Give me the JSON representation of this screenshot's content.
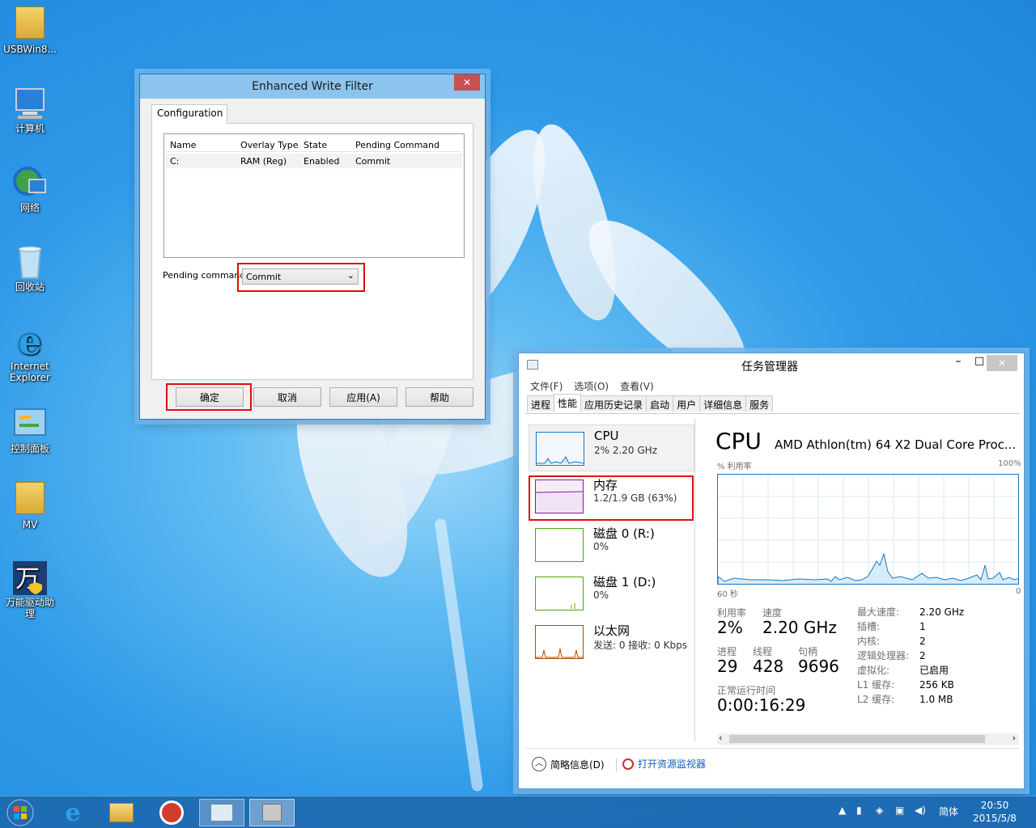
{
  "desktop": {
    "icons": [
      {
        "label": "USBWin8..."
      },
      {
        "label": "计算机"
      },
      {
        "label": "网络"
      },
      {
        "label": "回收站"
      },
      {
        "label": "Internet Explorer"
      },
      {
        "label": "控制面板"
      },
      {
        "label": "MV"
      },
      {
        "label": "万能驱动助理"
      }
    ]
  },
  "ewf": {
    "title": "Enhanced Write Filter",
    "close": "✕",
    "tab": "Configuration",
    "columns": [
      "Name",
      "Overlay Type",
      "State",
      "Pending Command"
    ],
    "rows": [
      {
        "name": "C:",
        "overlay": "RAM (Reg)",
        "state": "Enabled",
        "pending": "Commit"
      }
    ],
    "pending_label": "Pending command:",
    "pending_value": "Commit",
    "buttons": {
      "ok": "确定",
      "cancel": "取消",
      "apply": "应用(A)",
      "help": "帮助"
    }
  },
  "taskmgr": {
    "title": "任务管理器",
    "menu": [
      "文件(F)",
      "选项(O)",
      "查看(V)"
    ],
    "tabs": [
      "进程",
      "性能",
      "应用历史记录",
      "启动",
      "用户",
      "详细信息",
      "服务"
    ],
    "active_tab": "性能",
    "sidebar": [
      {
        "name": "CPU",
        "sub": "2% 2.20 GHz",
        "color": "#1379c2"
      },
      {
        "name": "内存",
        "sub": "1.2/1.9 GB (63%)",
        "color": "#8b12ae"
      },
      {
        "name": "磁盘 0 (R:)",
        "sub": "0%",
        "color": "#4da60c"
      },
      {
        "name": "磁盘 1 (D:)",
        "sub": "0%",
        "color": "#4da60c"
      },
      {
        "name": "以太网",
        "sub": "发送: 0 接收: 0 Kbps",
        "color": "#a74f01"
      }
    ],
    "cpu": {
      "heading": "CPU",
      "model": "AMD Athlon(tm) 64 X2 Dual Core Proc...",
      "graph_label": "% 利用率",
      "graph_max": "100%",
      "graph_time": "60 秒",
      "graph_min": "0",
      "utilization_label": "利用率",
      "utilization": "2%",
      "speed_label": "速度",
      "speed": "2.20 GHz",
      "processes_label": "进程",
      "processes": "29",
      "threads_label": "线程",
      "threads": "428",
      "handles_label": "句柄",
      "handles": "9696",
      "uptime_label": "正常运行时间",
      "uptime": "0:00:16:29",
      "details": [
        {
          "k": "最大速度:",
          "v": "2.20 GHz"
        },
        {
          "k": "插槽:",
          "v": "1"
        },
        {
          "k": "内核:",
          "v": "2"
        },
        {
          "k": "逻辑处理器:",
          "v": "2"
        },
        {
          "k": "虚拟化:",
          "v": "已启用"
        },
        {
          "k": "L1 缓存:",
          "v": "256 KB"
        },
        {
          "k": "L2 缓存:",
          "v": "1.0 MB"
        }
      ]
    },
    "footer": {
      "less": "简略信息(D)",
      "monitor": "打开资源监视器"
    }
  },
  "taskbar": {
    "ime": "简体",
    "time": "20:50",
    "date": "2015/5/8"
  }
}
